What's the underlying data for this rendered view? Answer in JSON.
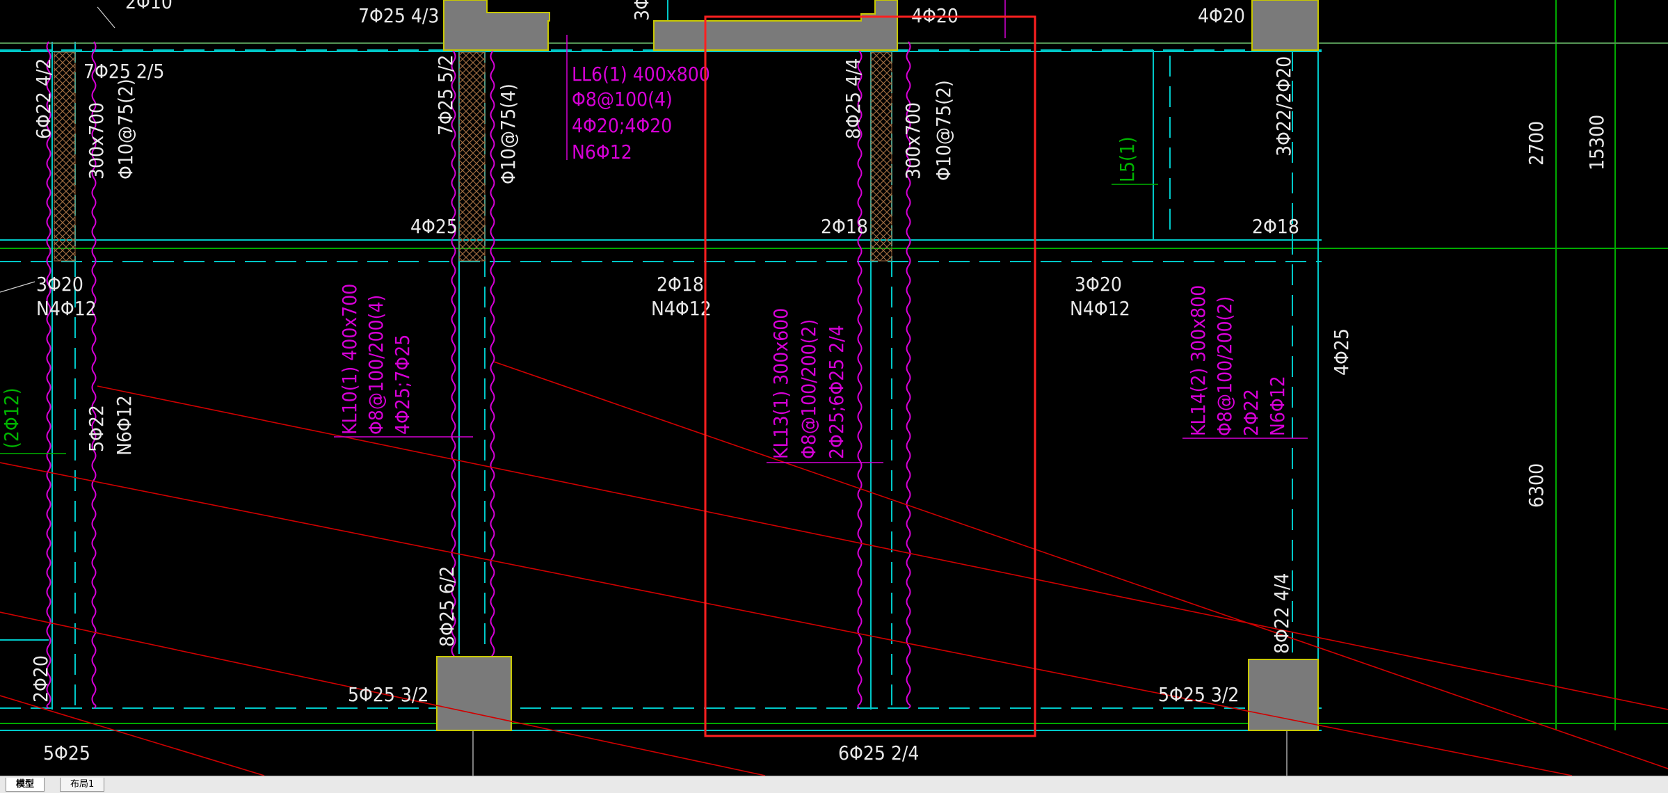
{
  "colors": {
    "background": "#000000",
    "beam_lines": "#00c8c8",
    "annotation_white": "#e8e8e8",
    "annotation_magenta": "#d600d6",
    "annotation_green": "#00b400",
    "column_fill": "#7a7a7a",
    "column_outline": "#c8c800",
    "section_cut": "#d00000",
    "highlight_box": "#ff2020",
    "grid_lines": "#00aa00"
  },
  "labels": {
    "top_row": {
      "t1": "2Φ10",
      "t2": "7Φ25 4/3",
      "t3": "3Φ",
      "t4": "4Φ20",
      "t5": "4Φ20"
    },
    "beam_left": {
      "top_bars": "7Φ25 2/5",
      "side_bars": "6Φ22 4/2",
      "size": "300x700",
      "stirrups": "Φ10@75(2)",
      "bottom_note_1": "3Φ20",
      "bottom_note_2": "N4Φ12",
      "mid_1": "5Φ22",
      "mid_2": "N6Φ12",
      "green_note": "(2Φ12)",
      "bottom_left": "2Φ20",
      "bottom_bars": "5Φ25"
    },
    "beam_col2": {
      "side_bars": "7Φ25 5/2",
      "stirrups": "Φ10@75(4)",
      "end_bars": "4Φ25",
      "lower_bars": "8Φ25 6/2",
      "bottom_bars": "5Φ25 3/2"
    },
    "ll6": {
      "name": "LL6(1) 400x800",
      "stirrups": "Φ8@100(4)",
      "bars": "4Φ20;4Φ20",
      "side": "N6Φ12"
    },
    "kl10": {
      "name": "KL10(1) 400x700",
      "stirrups": "Φ8@100/200(4)",
      "bars": "4Φ25;7Φ25"
    },
    "mid_span": {
      "bars": "2Φ18",
      "side": "N4Φ12"
    },
    "beam_col3": {
      "side_bars": "8Φ25 4/4",
      "size": "300x700",
      "stirrups": "Φ10@75(2)",
      "end_bars": "2Φ18"
    },
    "kl13": {
      "name": "KL13(1) 300x600",
      "stirrups": "Φ8@100/200(2)",
      "bars": "2Φ25;6Φ25 2/4"
    },
    "bottom_mid": {
      "bars": "6Φ25 2/4"
    },
    "right_span": {
      "bars": "3Φ20",
      "side": "N4Φ12"
    },
    "l5": "L5(1)",
    "beam_col4": {
      "side_bars": "3Φ22/2Φ20",
      "end_bars": "2Φ18",
      "mid_bars": "4Φ25",
      "lower_bars": "8Φ22 4/4",
      "bottom_bars": "5Φ25 3/2"
    },
    "kl14": {
      "name": "KL14(2) 300x800",
      "stirrups": "Φ8@100/200(2)",
      "bars": "2Φ22",
      "side": "N6Φ12"
    },
    "dimensions": {
      "d1": "2700",
      "d2": "15300",
      "d3": "6300"
    }
  },
  "tabs": [
    {
      "label": "模型",
      "active": true
    },
    {
      "label": "布局1",
      "active": false
    }
  ]
}
